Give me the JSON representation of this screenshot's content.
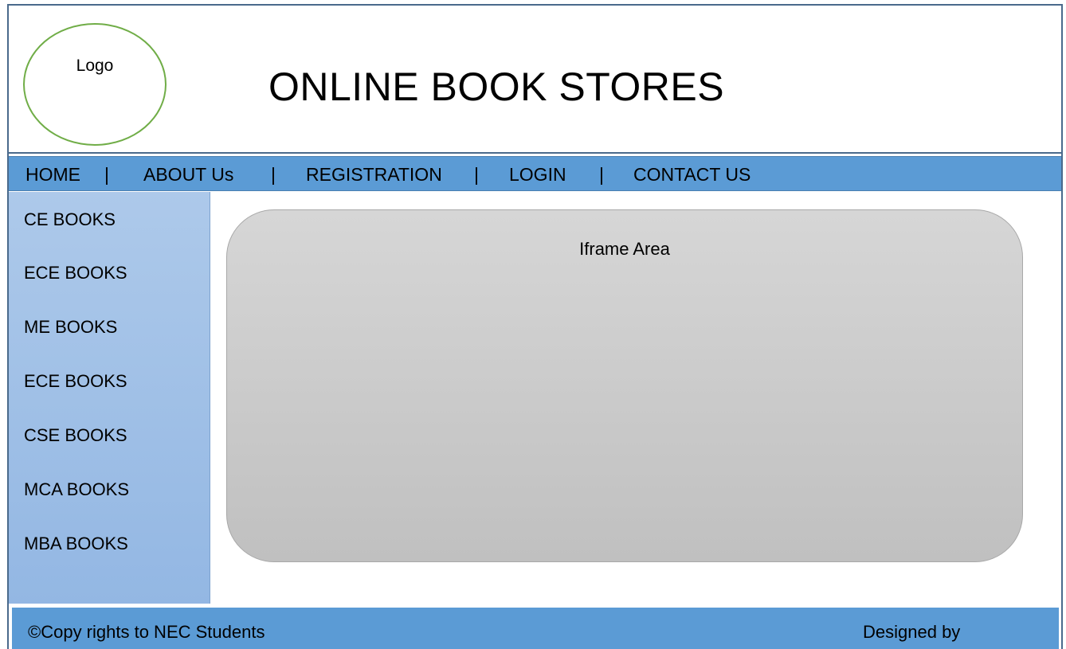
{
  "header": {
    "logo_text": "Logo",
    "title": "ONLINE BOOK STORES"
  },
  "nav": {
    "items": [
      "HOME",
      "ABOUT Us",
      "REGISTRATION",
      "LOGIN",
      "CONTACT US"
    ],
    "separator": "|"
  },
  "sidebar": {
    "items": [
      "CE BOOKS",
      "ECE BOOKS",
      "ME BOOKS",
      "ECE BOOKS",
      "CSE BOOKS",
      "MCA BOOKS",
      "MBA BOOKS"
    ]
  },
  "main": {
    "iframe_label": "Iframe Area"
  },
  "footer": {
    "copyright": "©Copy rights to NEC Students",
    "designed_by": "Designed by"
  },
  "colors": {
    "nav_bar": "#5b9bd5",
    "sidebar_top": "#adc9ea",
    "sidebar_bottom": "#93b7e3",
    "logo_outline": "#70ad47",
    "iframe_fill": "#cccccc",
    "frame_border": "#4a6a8c"
  }
}
